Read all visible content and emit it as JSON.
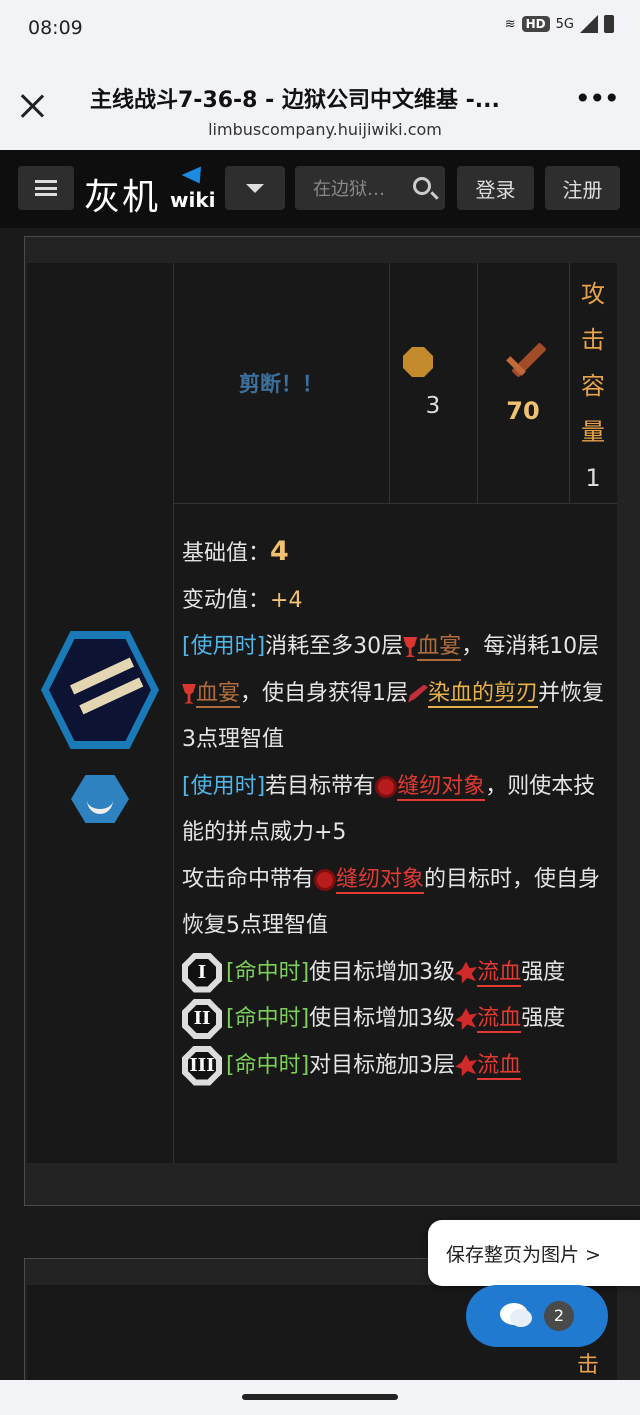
{
  "status": {
    "time": "08:09",
    "network": "5G",
    "hd": "HD"
  },
  "browser": {
    "title": "主线战斗7-36-8 - 边狱公司中文维基 -...",
    "url": "limbuscompany.huijiwiki.com"
  },
  "site": {
    "logo_cn": "灰机",
    "logo_wiki": "wiki",
    "search_placeholder": "在边狱…",
    "login_label": "登录",
    "register_label": "注册"
  },
  "skill": {
    "name": "剪断！！",
    "coin_count": "3",
    "power": "70",
    "attack_cap_label": [
      "攻",
      "击",
      "容",
      "量"
    ],
    "attack_cap_value": "1",
    "base_label": "基础值：",
    "base_value": "4",
    "var_label": "变动值：",
    "var_value": "+4",
    "use_tag": "[使用时]",
    "hit_tag": "[命中时]",
    "line1a": "消耗至多30层",
    "kw_feast": "血宴",
    "line1b": "，每消耗10层",
    "line1c": "，使自身获得1层",
    "kw_shears": "染血的剪刃",
    "line1d": "并恢复3点理智值",
    "line2a": "若目标带有",
    "kw_suture": "缝纫对象",
    "line2b": "，则使本技能的拼点威力+5",
    "line3a": "攻击命中带有",
    "line3b": "的目标时，使自身恢复5点理智值",
    "coin1_numeral": "I",
    "coin2_numeral": "II",
    "coin3_numeral": "III",
    "coin1_text": "使目标增加3级",
    "coin2_text": "使目标增加3级",
    "kw_bleed": "流血",
    "intensity": "强度",
    "coin3_text": "对目标施加3层"
  },
  "next_skill": {
    "attack_cap_partial": "击"
  },
  "popup": {
    "save_label": "保存整页为图片 >"
  },
  "chat": {
    "count": "2"
  }
}
